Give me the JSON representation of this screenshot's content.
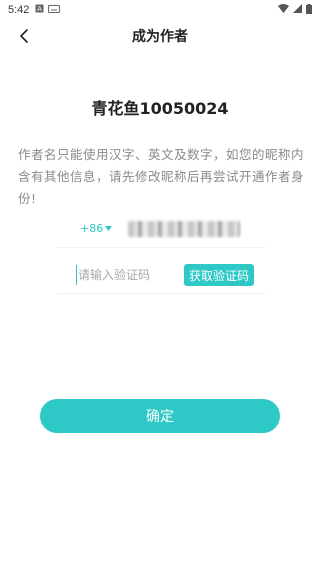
{
  "status_bar": {
    "time": "5:42",
    "icons": [
      "notification-a-icon",
      "keyboard-icon"
    ],
    "right_icons": [
      "wifi-icon",
      "signal-icon",
      "battery-icon"
    ]
  },
  "nav": {
    "title": "成为作者"
  },
  "user": {
    "name": "青花鱼10050024"
  },
  "notice": {
    "text": "作者名只能使用汉字、英文及数字，如您的昵称内含有其他信息，请先修改昵称后再尝试开通作者身份!"
  },
  "phone": {
    "country_code": "+86"
  },
  "verify": {
    "placeholder": "请输入验证码",
    "get_code_label": "获取验证码"
  },
  "confirm": {
    "label": "确定"
  },
  "colors": {
    "accent": "#2ec9c6",
    "text_primary": "#222222",
    "text_secondary": "#8a8a8a"
  }
}
